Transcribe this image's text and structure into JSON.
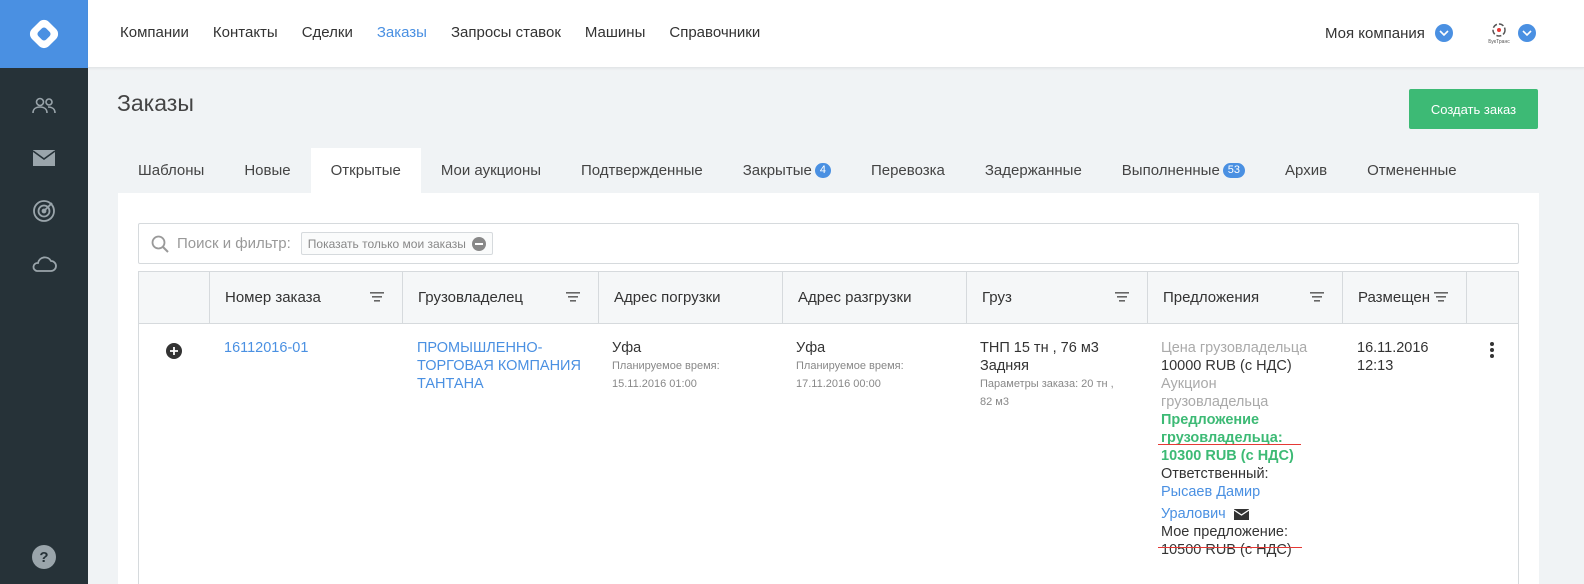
{
  "nav": {
    "items": [
      "Компании",
      "Контакты",
      "Сделки",
      "Заказы",
      "Запросы ставок",
      "Машины",
      "Справочники"
    ],
    "active_index": 3,
    "company": "Моя компания",
    "avatar_caption": "БукТранс"
  },
  "sidebar": {
    "icons": [
      "people-icon",
      "mail-icon",
      "radar-icon",
      "cloud-icon",
      "help-icon"
    ]
  },
  "page": {
    "title": "Заказы",
    "create_button": "Создать заказ"
  },
  "tabs": [
    {
      "label": "Шаблоны",
      "badge": ""
    },
    {
      "label": "Новые",
      "badge": ""
    },
    {
      "label": "Открытые",
      "badge": ""
    },
    {
      "label": "Мои аукционы",
      "badge": ""
    },
    {
      "label": "Подтвержденные",
      "badge": ""
    },
    {
      "label": "Закрытые",
      "badge": "4"
    },
    {
      "label": "Перевозка",
      "badge": ""
    },
    {
      "label": "Задержанные",
      "badge": ""
    },
    {
      "label": "Выполненные",
      "badge": "53"
    },
    {
      "label": "Архив",
      "badge": ""
    },
    {
      "label": "Отмененные",
      "badge": ""
    }
  ],
  "active_tab": 2,
  "search": {
    "label": "Поиск и фильтр:",
    "chip": "Показать только мои заказы"
  },
  "table": {
    "headers": [
      "Номер заказа",
      "Грузовладелец",
      "Адрес погрузки",
      "Адрес разгрузки",
      "Груз",
      "Предложения",
      "Размещен"
    ],
    "row": {
      "order_no": "16112016-01",
      "owner": [
        "ПРОМЫШЛЕННО-",
        "ТОРГОВАЯ КОМПАНИЯ",
        "ТАНТАНА"
      ],
      "load_city": "Уфа",
      "load_label": "Планируемое время:",
      "load_time": "15.11.2016 01:00",
      "unload_city": "Уфа",
      "unload_label": "Планируемое время:",
      "unload_time": "17.11.2016 00:00",
      "cargo_main": "ТНП 15 тн , 76 м3",
      "cargo_type": "Задняя",
      "cargo_params_1": "Параметры заказа: 20 тн ,",
      "cargo_params_2": "82 м3",
      "offers": {
        "price_label": "Цена грузовладельца",
        "price_value": "10000 RUB (с НДС)",
        "auction_1": "Аукцион",
        "auction_2": "грузовладельца",
        "proposal_1": "Предложение",
        "proposal_2": "грузовладельца:",
        "proposal_3": "10300 RUB (с НДС)",
        "responsible_label": "Ответственный:",
        "responsible_1": "Рысаев Дамир",
        "responsible_2": "Уралович",
        "my_offer_label": "Мое предложение:",
        "my_offer_value": "10500 RUB (с НДС)"
      },
      "placed_date": "16.11.2016",
      "placed_time": "12:13"
    }
  },
  "colors": {
    "accent": "#4a90e2",
    "sidebar": "#263238",
    "green": "#3dba75",
    "underline": "#e53935"
  }
}
